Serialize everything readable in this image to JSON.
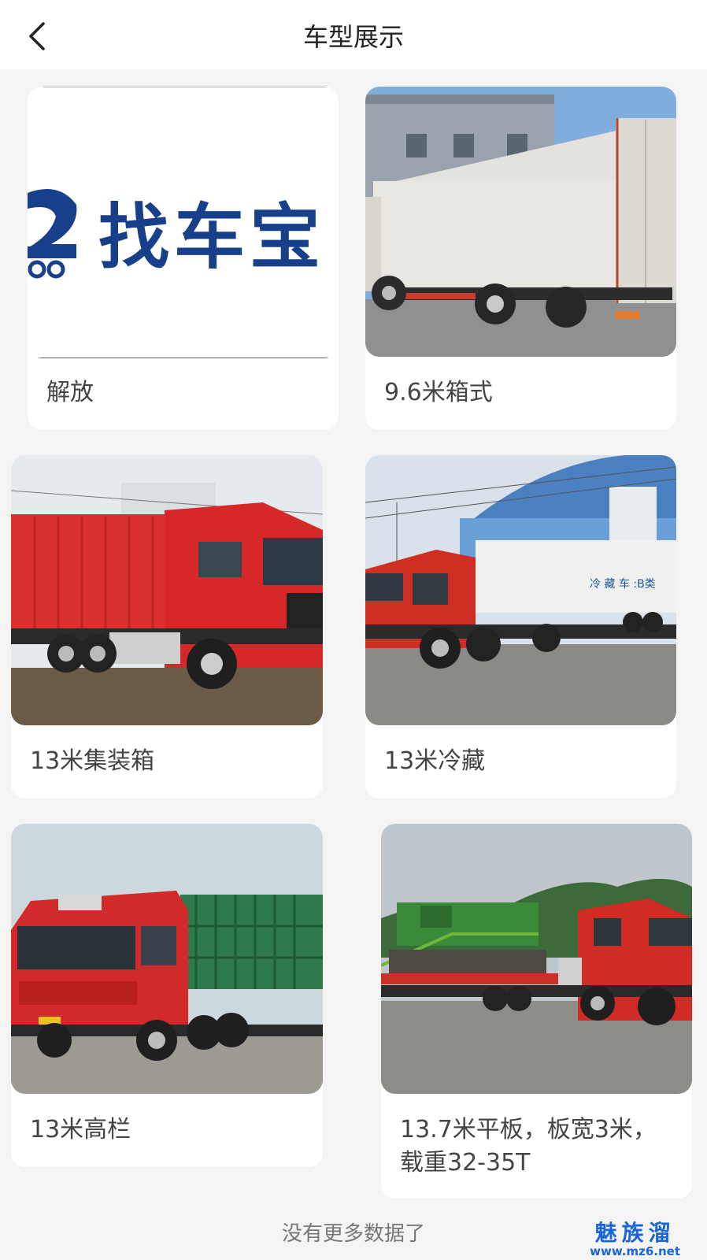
{
  "header": {
    "title": "车型展示",
    "back_icon": "chevron-left-icon"
  },
  "cards": [
    {
      "label": "解放",
      "logo_text": "找车宝"
    },
    {
      "label": "9.6米箱式"
    },
    {
      "label": "13米集装箱"
    },
    {
      "label": "13米冷藏",
      "truck_text": "冷 藏 车 :B类"
    },
    {
      "label": "13米高栏"
    },
    {
      "label": "13.7米平板，板宽3米，载重32-35T"
    }
  ],
  "footer": {
    "text": "没有更多数据了"
  },
  "watermark": {
    "main": "魅族溜",
    "sub": "www.mz6.net"
  }
}
